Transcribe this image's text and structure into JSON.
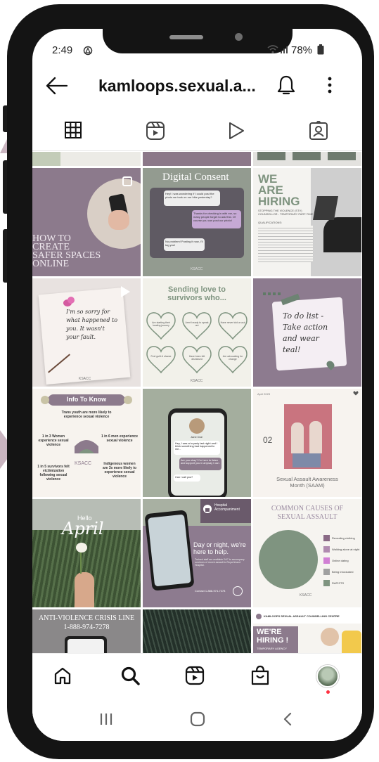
{
  "status_bar": {
    "time": "2:49",
    "battery": "78%"
  },
  "header": {
    "username": "kamloops.sexual.a..."
  },
  "tabs": [
    "grid",
    "reels",
    "video",
    "tagged"
  ],
  "posts": {
    "p1": {
      "lines": [
        "HOW TO",
        "CREATE",
        "SAFER SPACES",
        "ONLINE"
      ]
    },
    "p2": {
      "title": "Digital Consent",
      "bubble1": "Hey! I was wondering if I could post the photo we took on our hike yesterday?",
      "bubble2": "Thanks for checking in with me, so many people forget to ask first. Of course you can post our photo!",
      "bubble3": "No problem! Posting it now, I'll tag you!",
      "org": "KSACC"
    },
    "p3": {
      "title_lines": [
        "WE",
        "ARE",
        "HIRING"
      ],
      "subtitle": "STOPPING THE VIOLENCE (STV) COUNSELLOR - TEMPORARY PART-TIME",
      "qualifications": "QUALIFICATIONS:"
    },
    "p4": {
      "note_lines": [
        "I'm so sorry for",
        "what happened to",
        "you. It wasn't",
        "your fault."
      ],
      "org": "KSACC"
    },
    "p5": {
      "title_lines": [
        "Sending love to",
        "survivors who..."
      ],
      "hearts": [
        "Are starting their healing journey",
        "Aren't ready to speak out",
        "Have never told a soul",
        "Feel guilt & shame",
        "Have been felt dismissed",
        "Are advocating for change"
      ],
      "org": "KSACC"
    },
    "p6": {
      "note_lines": [
        "To do list -",
        "Take action",
        "and wear",
        "teal!"
      ]
    },
    "p7": {
      "title": "Info To Know",
      "stat_top": "Trans youth are more likely to experience sexual violence",
      "stat_l1": "1 in 3 Women experience sexual violence",
      "stat_r1": "1 in 6 men experience sexual violence",
      "stat_l2": "1 in 5 survivors felt victimization following sexual violence",
      "stat_r2": "Indigenous women are 3x more likely to experience sexual violence",
      "org": "KSACC"
    },
    "p8": {
      "name": "Jane Doe",
      "msg1": "Hey, I was at a party last night and I think something bad happened to me...",
      "msg2": "Are you okay? I'm here to listen and support you in anyway I can.",
      "msg3": "Can I call you?"
    },
    "p9": {
      "date": "April 2023",
      "number": "02",
      "title_lines": [
        "Sexual Assault Awareness",
        "Month (SAAM)"
      ]
    },
    "p10": {
      "hello": "Hello",
      "month": "April"
    },
    "p11": {
      "badge": "Hospital Accompaniment",
      "headline_lines": [
        "Day or night, we're",
        "here to help."
      ],
      "body": "Trained staff are available 24/7 to accompany survivors of recent assault to Royal Inland Hospital.",
      "contact": "Contact 1-888-974-7278"
    },
    "p12": {
      "title_lines": [
        "COMMON CAUSES OF",
        "SEXUAL ASSAULT"
      ],
      "legend": [
        "Revealing clothing",
        "Walking alone at night",
        "Online dating",
        "Being intoxicated",
        "RAPISTS"
      ],
      "legend_colors": [
        "#8a6a86",
        "#b08bb0",
        "#d17fd4",
        "#a0a0a0",
        "#7f9480"
      ],
      "org": "KSACC"
    },
    "p13": {
      "lines": [
        "ANTI-VIOLENCE CRISIS LINE",
        "1-888-974-7278"
      ]
    },
    "p15": {
      "org_name": "KAMLOOPS SEXUAL ASSAULT COUNSELLING CENTRE",
      "headline_lines": [
        "WE'RE",
        "HIRING !"
      ],
      "sub": "TEMPORARY AGENCY"
    }
  },
  "bottom_nav": [
    "home",
    "search",
    "reels",
    "shop",
    "profile"
  ],
  "system_nav": [
    "recents",
    "home",
    "back"
  ]
}
